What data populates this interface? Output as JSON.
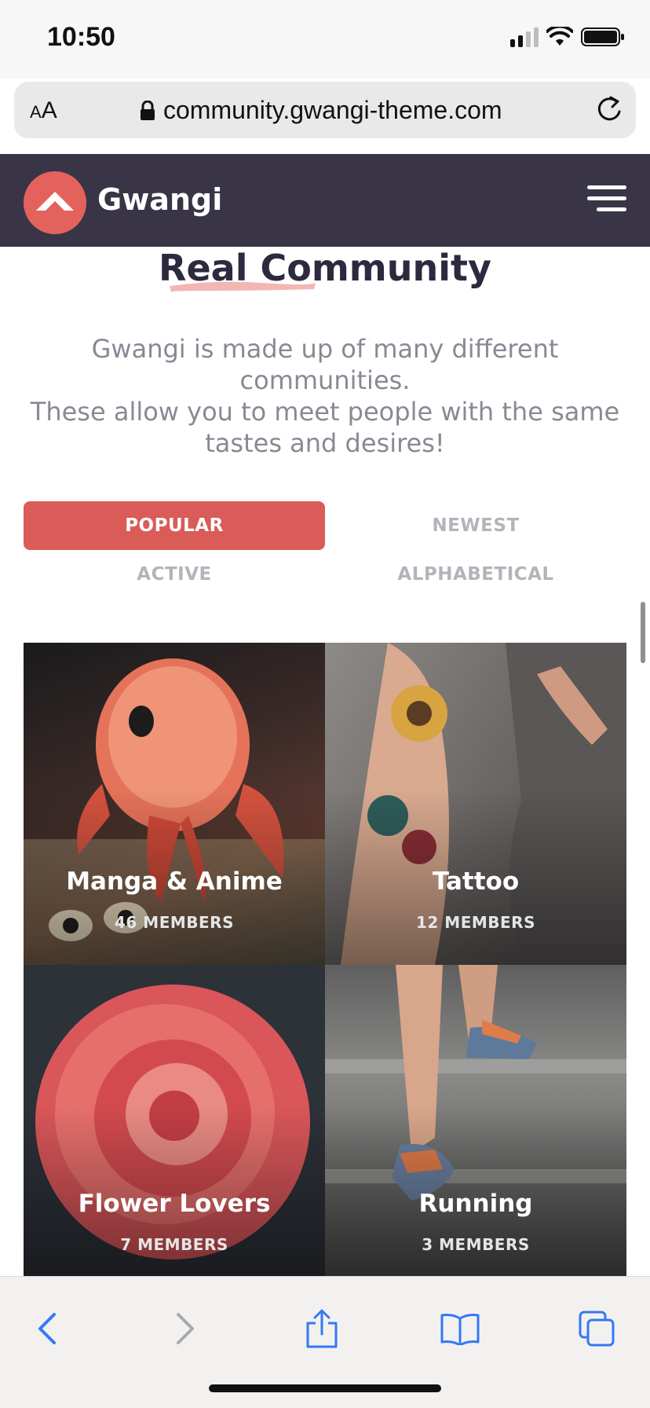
{
  "status_bar": {
    "time": "10:50"
  },
  "browser": {
    "text_size_label_small": "A",
    "text_size_label_large": "A",
    "url": "community.gwangi-theme.com"
  },
  "site": {
    "brand": "Gwangi"
  },
  "section": {
    "title": "Real Community",
    "intro_line_1": "Gwangi is made up of many different communities.",
    "intro_line_2": "These allow you to meet people with the same tastes and desires!"
  },
  "filters": [
    {
      "label": "POPULAR",
      "active": true
    },
    {
      "label": "NEWEST",
      "active": false
    },
    {
      "label": "ACTIVE",
      "active": false
    },
    {
      "label": "ALPHABETICAL",
      "active": false
    }
  ],
  "groups": [
    {
      "name": "Manga & Anime",
      "members": "46 MEMBERS"
    },
    {
      "name": "Tattoo",
      "members": "12 MEMBERS"
    },
    {
      "name": "Flower Lovers",
      "members": "7 MEMBERS"
    },
    {
      "name": "Running",
      "members": "3 MEMBERS"
    }
  ],
  "colors": {
    "header_bg": "#393547",
    "accent": "#d95c58",
    "safari_blue": "#3478f6"
  },
  "icons": {
    "back": "chevron-left-icon",
    "forward": "chevron-right-icon",
    "share": "share-icon",
    "bookmarks": "book-icon",
    "tabs": "tabs-icon"
  }
}
